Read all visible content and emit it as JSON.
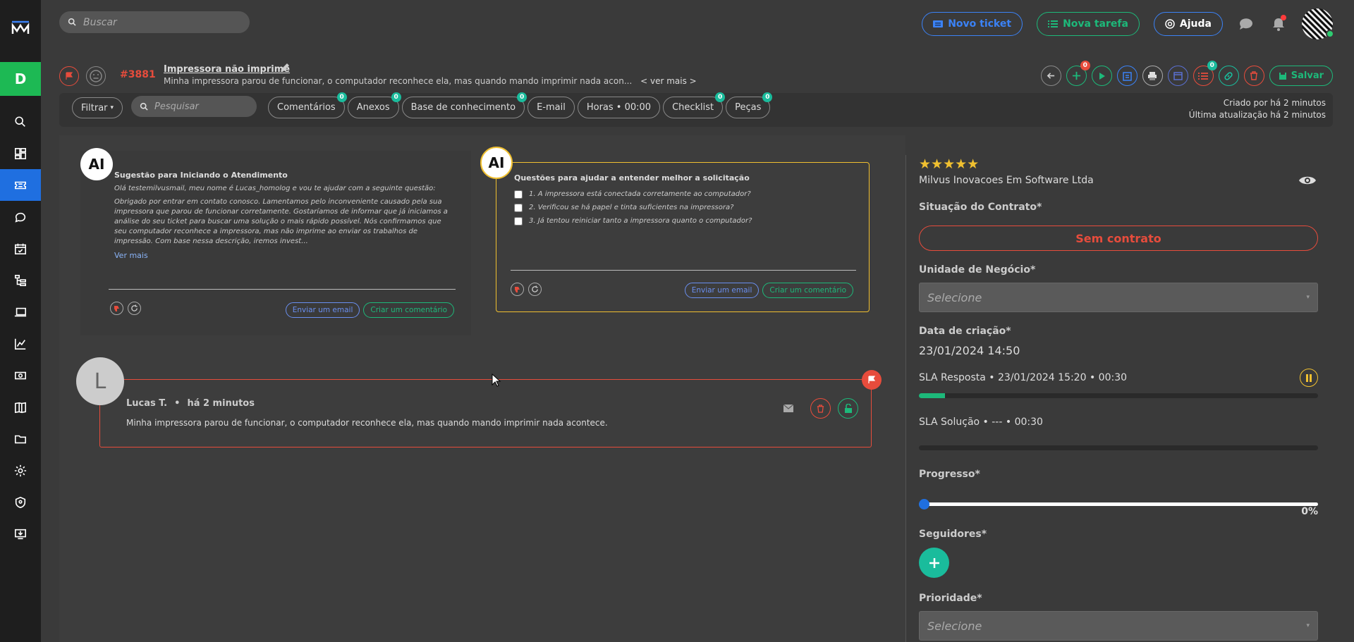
{
  "sidebar": {
    "logo": "M",
    "user_initial": "D",
    "items": [
      "search-icon",
      "dashboard-icon",
      "ticket-icon",
      "chat-icon",
      "calendar-icon",
      "tree-icon",
      "devices-icon",
      "chart-icon",
      "money-icon",
      "book-icon",
      "folder-icon",
      "gear-icon",
      "shield-icon",
      "download-icon"
    ],
    "active_index": 2
  },
  "topbar": {
    "search_placeholder": "Buscar",
    "novo_ticket": "Novo ticket",
    "nova_tarefa": "Nova tarefa",
    "ajuda": "Ajuda"
  },
  "ticket": {
    "number": "#3881",
    "title": "Impressora não imprime",
    "description": "Minha impressora parou de funcionar, o computador reconhece ela, mas quando mando imprimir nada acon...",
    "ver_mais": "< ver mais >",
    "save": "Salvar",
    "badges": {
      "add": "0",
      "checklist": "0"
    }
  },
  "tabsbar": {
    "filtrar": "Filtrar",
    "search_placeholder": "Pesquisar",
    "tabs": [
      {
        "label": "Comentários",
        "badge": "0"
      },
      {
        "label": "Anexos",
        "badge": "0"
      },
      {
        "label": "Base de conhecimento",
        "badge": "0"
      },
      {
        "label": "E-mail",
        "badge": ""
      },
      {
        "label": "Horas • 00:00",
        "badge": ""
      },
      {
        "label": "Checklist",
        "badge": "0"
      },
      {
        "label": "Peças",
        "badge": "0"
      }
    ],
    "created": "Criado por há 2 minutos",
    "updated": "Última atualização há 2 minutos"
  },
  "ai_suggestion": {
    "avatar": "AI",
    "title": "Sugestão para Iniciando o Atendimento",
    "greeting": "Olá testemilvusmail, meu nome é Lucas_homolog e vou te ajudar com a seguinte questão:",
    "body": "Obrigado por entrar em contato conosco. Lamentamos pelo inconveniente causado pela sua impressora que parou de funcionar corretamente. Gostaríamos de informar que já iniciamos a análise do seu ticket para buscar uma solução o mais rápido possível. Nós confirmamos que seu computador reconhece a impressora, mas não imprime ao enviar os trabalhos de impressão. Com base nessa descrição, iremos invest...",
    "ver_mais": "Ver mais",
    "send_email": "Enviar um email",
    "create_comment": "Criar um comentário"
  },
  "ai_questions": {
    "avatar": "AI",
    "title": "Questões para ajudar a entender melhor a solicitação",
    "questions": [
      "1. A impressora está conectada corretamente ao computador?",
      "2. Verificou se há papel e tinta suficientes na impressora?",
      "3. Já tentou reiniciar tanto a impressora quanto o computador?"
    ],
    "send_email": "Enviar um email",
    "create_comment": "Criar um comentário"
  },
  "comment": {
    "initial": "L",
    "author": "Lucas T.",
    "time": "há 2 minutos",
    "text": "Minha impressora parou de funcionar, o computador reconhece ela, mas quando mando imprimir nada acontece."
  },
  "right_panel": {
    "rating": 5,
    "company": "Milvus Inovacoes Em Software Ltda",
    "contract_label": "Situação do Contrato*",
    "contract_value": "Sem contrato",
    "business_unit_label": "Unidade de Negócio*",
    "select_placeholder": "Selecione",
    "creation_date_label": "Data de criação*",
    "creation_date": "23/01/2024 14:50",
    "sla_response": "SLA Resposta • 23/01/2024 15:20 • 00:30",
    "sla_response_progress": 0.065,
    "sla_solution": "SLA Solução • --- • 00:30",
    "sla_solution_progress": 0,
    "progress_label": "Progresso*",
    "progress_value": "0%",
    "progress": 0,
    "followers_label": "Seguidores*",
    "priority_label": "Prioridade*"
  },
  "colors": {
    "accent_blue": "#1f6fe0",
    "green": "#1db97a",
    "red": "#e74c3c",
    "yellow": "#f0c030"
  }
}
